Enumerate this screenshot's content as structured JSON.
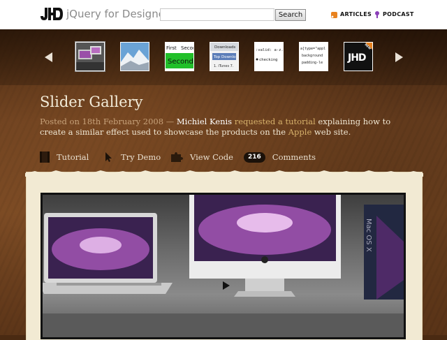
{
  "header": {
    "logo_mark": "JHD",
    "logo_text": "jQuery for Designers",
    "search": {
      "placeholder": "",
      "value": "",
      "button_label": "Search"
    },
    "nav": [
      {
        "label": "ARTICLES",
        "icon": "rss-icon"
      },
      {
        "label": "PODCAST",
        "icon": "podcast-icon"
      }
    ]
  },
  "gallery": {
    "prev_icon": "arrow-left-icon",
    "next_icon": "arrow-right-icon",
    "thumbs": [
      {
        "name": "thumb-slider-gallery",
        "active": true
      },
      {
        "name": "thumb-snow-photo",
        "active": false
      },
      {
        "name": "thumb-first-second",
        "texts": [
          "First",
          "Secon",
          "Second"
        ]
      },
      {
        "name": "thumb-downloads",
        "texts": [
          "Downloads",
          "Top Downlo",
          "1. iTunes 7..."
        ]
      },
      {
        "name": "thumb-code-valid",
        "texts": [
          ":valid: a-z...",
          "checking"
        ]
      },
      {
        "name": "thumb-code-css",
        "texts": [
          "a[type=\"appl",
          "background",
          "padding-le"
        ]
      },
      {
        "name": "thumb-jhd-logo",
        "texts": [
          "JHD",
          "NEW"
        ]
      }
    ]
  },
  "article": {
    "title": "Slider Gallery",
    "meta": {
      "posted": "Posted on 18th February 2008 — ",
      "author": "Michiel Kenis",
      "requested": " requested a tutorial",
      "rest1": " explaining how to create a similar effect used to showcase the products on the ",
      "apple": "Apple",
      "rest2": " web site."
    },
    "actions": {
      "tutorial": "Tutorial",
      "demo": "Try Demo",
      "code": "View Code",
      "comment_count": "216",
      "comments": "Comments"
    }
  },
  "colors": {
    "leather": "#6b4020",
    "paper": "#f2ead3",
    "title": "#f3ecd9",
    "link": "#d6b16b"
  }
}
